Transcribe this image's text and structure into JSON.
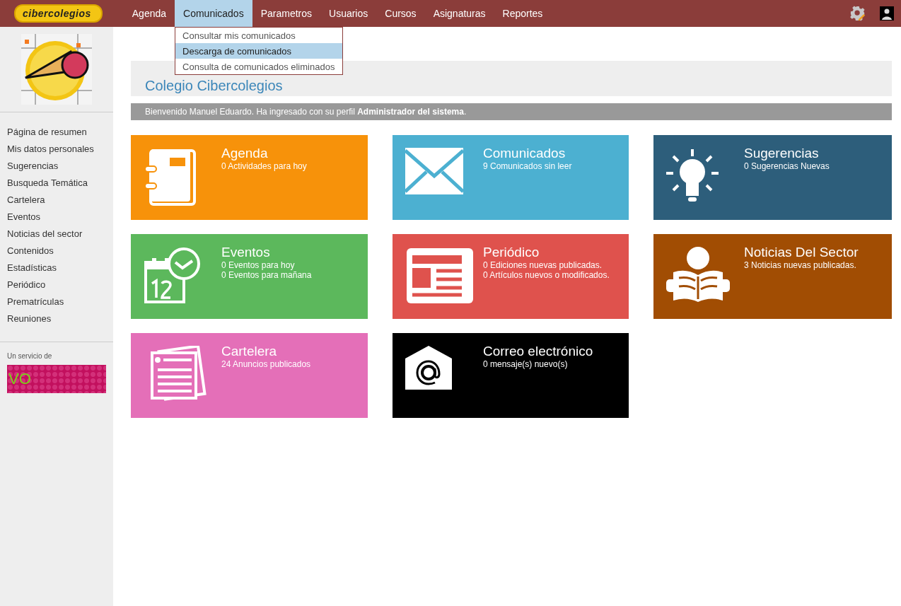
{
  "topbar": {
    "logo_text": "cibercolegios",
    "menu": [
      {
        "label": "Agenda",
        "selected": false
      },
      {
        "label": "Comunicados",
        "selected": true
      },
      {
        "label": "Parametros",
        "selected": false
      },
      {
        "label": "Usuarios",
        "selected": false
      },
      {
        "label": "Cursos",
        "selected": false
      },
      {
        "label": "Asignaturas",
        "selected": false
      },
      {
        "label": "Reportes",
        "selected": false
      }
    ],
    "dropdown": [
      {
        "label": "Consultar mis comunicados",
        "selected": false
      },
      {
        "label": "Descarga de comunicados",
        "selected": true
      },
      {
        "label": "Consulta de comunicados eliminados",
        "selected": false
      }
    ]
  },
  "sidebar": {
    "items": [
      "Página de resumen",
      "Mis datos personales",
      "Sugerencias",
      "Busqueda Temática",
      "Cartelera",
      "Eventos",
      "Noticias del sector",
      "Contenidos",
      "Estadísticas",
      "Periódico",
      "Prematrículas",
      "Reuniones"
    ],
    "service_label": "Un servicio de",
    "banner_text": "VO"
  },
  "header": {
    "title": "Colegio Cibercolegios"
  },
  "welcome": "Bienvenido Manuel Eduardo. Ha ingresado con su perfil **Administrador del sistema**.",
  "tiles": [
    {
      "kind": "agenda",
      "title": "Agenda",
      "lines": [
        "0 Actividades para hoy"
      ],
      "color": "#f7920a"
    },
    {
      "kind": "mail",
      "title": "Comunicados",
      "lines": [
        "9 Comunicados sin leer"
      ],
      "color": "#4cb0d1"
    },
    {
      "kind": "bulb",
      "title": "Sugerencias",
      "lines": [
        "0 Sugerencias Nuevas"
      ],
      "color": "#2d5e7b"
    },
    {
      "kind": "calendar",
      "title": "Eventos",
      "lines": [
        "0 Eventos para hoy",
        "0 Eventos para mañana"
      ],
      "color": "#5cb85c"
    },
    {
      "kind": "newspaper",
      "title": "Periódico",
      "lines": [
        "0 Ediciones nuevas publicadas.",
        "0 Artículos nuevos o modificados."
      ],
      "color": "#df524d"
    },
    {
      "kind": "reader",
      "title": "Noticias Del Sector",
      "lines": [
        "3 Noticias nuevas publicadas."
      ],
      "color": "#a14d03"
    },
    {
      "kind": "papers",
      "title": "Cartelera",
      "lines": [
        "24 Anuncios publicados"
      ],
      "color": "#e46fb8"
    },
    {
      "kind": "email",
      "title": "Correo electrónico",
      "lines": [
        "0 mensaje(s) nuevo(s)"
      ],
      "color": "#000000"
    }
  ]
}
